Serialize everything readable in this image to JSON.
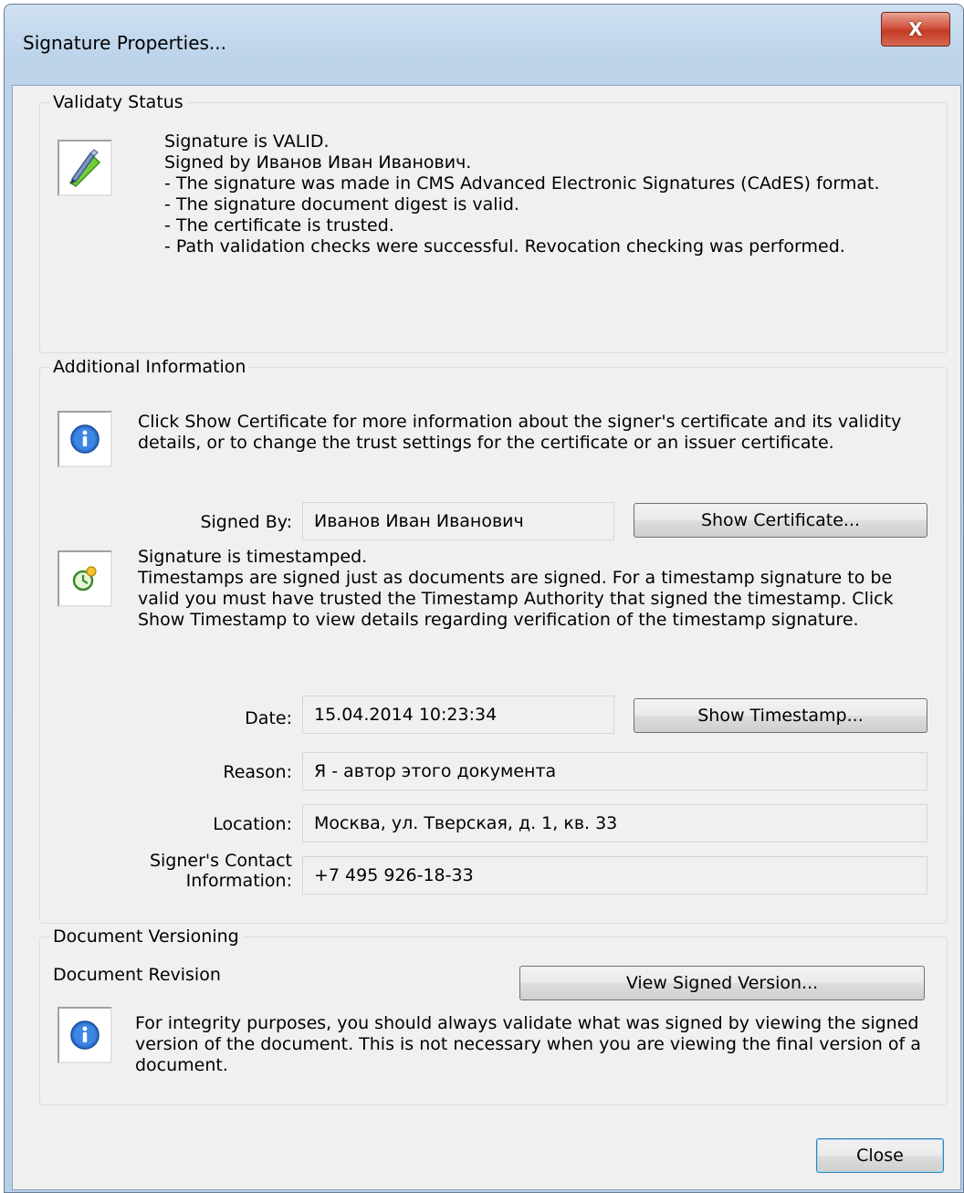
{
  "window": {
    "title": "Signature Properties...",
    "close_glyph": "X"
  },
  "validity": {
    "legend": "Validaty Status",
    "icon": "signature-pen-icon",
    "lines": [
      "Signature is VALID.",
      "Signed by Иванов Иван Иванович.",
      "- The signature was made in CMS Advanced Electronic Signatures (CAdES) format.",
      "- The signature document digest is valid.",
      "- The certificate is trusted.",
      "- Path validation checks were successful. Revocation checking was performed."
    ]
  },
  "additional": {
    "legend": "Additional Information",
    "info_icon": "info-icon",
    "info_text": "Click Show Certificate for more information about the signer's certificate and its validity details, or to change the trust settings for the certificate or an issuer certificate.",
    "signed_by_label": "Signed By:",
    "signed_by_value": "Иванов Иван Иванович",
    "show_certificate_label": "Show Certificate...",
    "timestamp_icon": "timestamp-clock-icon",
    "timestamp_title": "Signature is timestamped.",
    "timestamp_text": "Timestamps are signed just as documents are signed. For a timestamp signature to be valid you must have trusted  the Timestamp Authority that signed the timestamp. Click Show Timestamp to view details regarding verification of the timestamp signature.",
    "date_label": "Date:",
    "date_value": "15.04.2014 10:23:34",
    "show_timestamp_label": "Show Timestamp...",
    "reason_label": "Reason:",
    "reason_value": "Я - автор этого документа",
    "location_label": "Location:",
    "location_value": "Москва, ул. Тверская, д. 1, кв. 33",
    "contact_label_line1": "Signer's Contact",
    "contact_label_line2": "Information:",
    "contact_value": "+7 495 926-18-33"
  },
  "versioning": {
    "legend": "Document Versioning",
    "revision_label": "Document Revision",
    "view_signed_label": "View Signed Version...",
    "info_icon": "info-icon",
    "info_text": "For integrity purposes, you should always validate what was signed by viewing the signed version of the document. This is not necessary when you are viewing the final version of a document."
  },
  "footer": {
    "close_label": "Close"
  },
  "colors": {
    "window_frame": "#b9d1ea",
    "close_button": "#c94630",
    "dialog_bg": "#f0f0f0",
    "info_blue": "#1e64c8"
  }
}
